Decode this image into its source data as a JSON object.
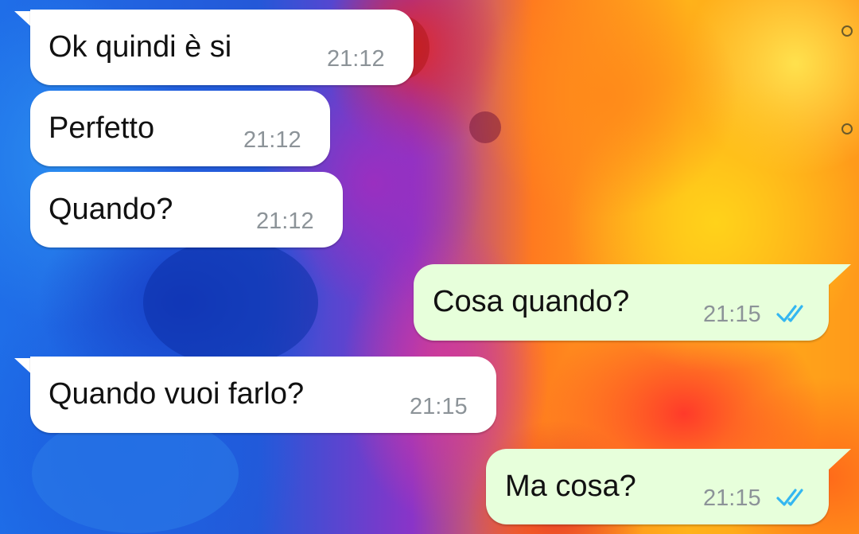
{
  "colors": {
    "incoming_bubble": "#ffffff",
    "outgoing_bubble": "#e7ffdb",
    "timestamp": "#8c9398",
    "read_ticks": "#34b7f1"
  },
  "messages": [
    {
      "direction": "incoming",
      "text": "Ok quindi è si",
      "time": "21:12"
    },
    {
      "direction": "incoming",
      "text": "Perfetto",
      "time": "21:12"
    },
    {
      "direction": "incoming",
      "text": "Quando?",
      "time": "21:12"
    },
    {
      "direction": "outgoing",
      "text": "Cosa quando?",
      "time": "21:15",
      "status": "read-double-check-icon"
    },
    {
      "direction": "incoming",
      "text": "Quando vuoi farlo?",
      "time": "21:15"
    },
    {
      "direction": "outgoing",
      "text": "Ma cosa?",
      "time": "21:15",
      "status": "read-double-check-icon"
    }
  ]
}
